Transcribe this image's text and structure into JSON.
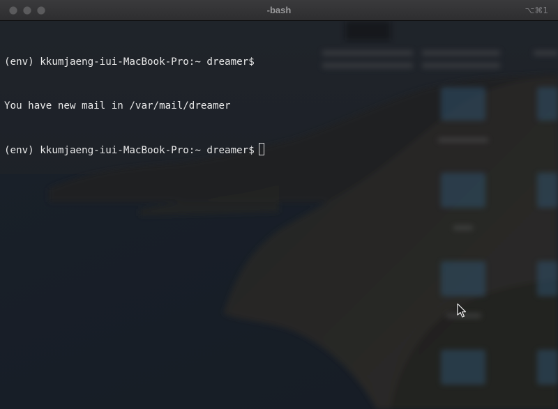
{
  "window": {
    "title": "-bash",
    "shortcut": "⌥⌘1",
    "buttons": [
      "close",
      "minimize",
      "zoom"
    ]
  },
  "terminal": {
    "lines": [
      {
        "prompt": "(env) kkumjaeng-iui-MacBook-Pro:~ dreamer$",
        "text": ""
      },
      {
        "prompt": "",
        "text": "You have new mail in /var/mail/dreamer"
      },
      {
        "prompt": "(env) kkumjaeng-iui-MacBook-Pro:~ dreamer$",
        "text": ""
      }
    ],
    "cursor_visible": true
  },
  "colors": {
    "titlebar": "#333335",
    "title_text": "#9a9a9c",
    "terminal_text": "#e9e9e9",
    "background": "#20242a"
  },
  "icons": {
    "close": "close-icon",
    "minimize": "minimize-icon",
    "zoom": "zoom-icon",
    "pointer": "mouse-pointer-icon"
  }
}
